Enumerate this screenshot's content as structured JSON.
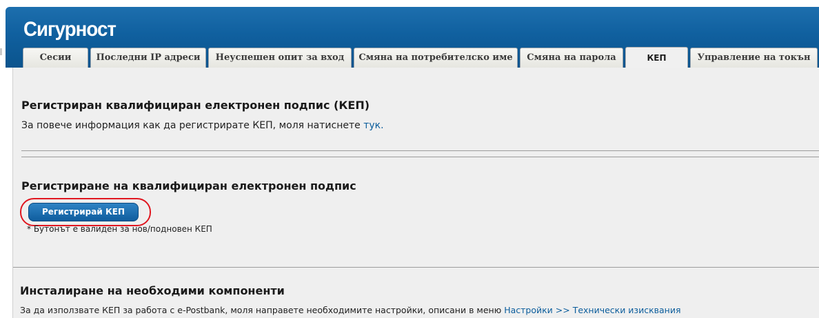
{
  "header": {
    "title": "Сигурност"
  },
  "tabs": [
    {
      "label": "Сесии",
      "active": false
    },
    {
      "label": "Последни IP адреси",
      "active": false
    },
    {
      "label": "Неуспешен опит за вход",
      "active": false
    },
    {
      "label": "Смяна на потребителско име",
      "active": false
    },
    {
      "label": "Смяна на парола",
      "active": false
    },
    {
      "label": "КЕП",
      "active": true
    },
    {
      "label": "Управление на токън",
      "active": false
    }
  ],
  "registered_section": {
    "title": "Регистриран квалифициран електронен подпис (КЕП)",
    "info_text": "За повече информация как да регистрирате КЕП, моля натиснете ",
    "info_link": "тук."
  },
  "register_section": {
    "title": "Регистриране на квалифициран електронен подпис",
    "button_label": "Регистрирай КЕП",
    "note": "* Бутонът е валиден за нов/подновен КЕП"
  },
  "components_section": {
    "title": "Инсталиране на необходими компоненти",
    "info_text": "За да използвате КЕП за работа с е-Postbank, моля направете необходимите настройки, описани в меню ",
    "info_link": "Настройки >> Технически изисквания"
  },
  "colors": {
    "header": "#10609f",
    "link": "#0b5d9c",
    "button": "#1a6db0",
    "highlight": "#e0161f",
    "content_bg": "#efefef"
  }
}
